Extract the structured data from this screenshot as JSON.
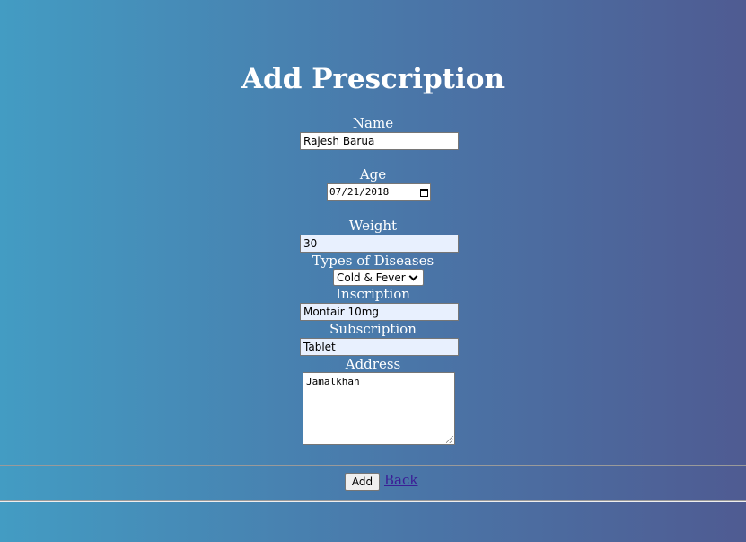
{
  "page": {
    "title": "Add Prescription"
  },
  "form": {
    "name": {
      "label": "Name",
      "value": "Rajesh Barua"
    },
    "age": {
      "label": "Age",
      "value": "07/21/2018"
    },
    "weight": {
      "label": "Weight",
      "value": "30"
    },
    "disease": {
      "label": "Types of Diseases",
      "selected": "Cold & Fever"
    },
    "inscription": {
      "label": "Inscription",
      "value": "Montair 10mg"
    },
    "subscription": {
      "label": "Subscription",
      "value": "Tablet"
    },
    "address": {
      "label": "Address",
      "value": "Jamalkhan"
    }
  },
  "actions": {
    "add_label": "Add",
    "back_label": "Back"
  },
  "icons": {
    "calendar": "calendar-icon",
    "dropdown": "chevron-down-icon",
    "resize": "resize-handle-icon"
  },
  "colors": {
    "background_left": "#439cc3",
    "background_right": "#4f5b92",
    "autofill_fill": "#e8f0fe",
    "link": "#3b1e96"
  }
}
